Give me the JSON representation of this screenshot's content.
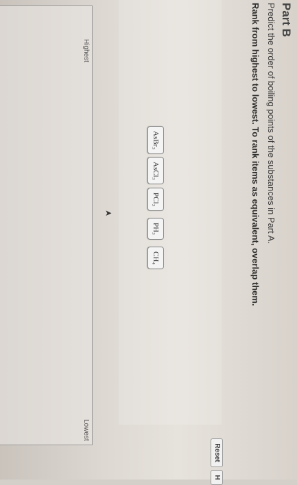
{
  "part": {
    "title": "Part B"
  },
  "question": {
    "instruction": "Predict the order of boiling points of the substances in Part A.",
    "rank_main": "Rank from highest to lowest. To rank items as equivalent, overlap them."
  },
  "toolbar": {
    "reset_label": "Reset",
    "help_label": "H"
  },
  "items": [
    {
      "formula": "AsBr₃"
    },
    {
      "formula": "AsCl₃"
    },
    {
      "formula": "PCl₃"
    },
    {
      "formula": "PH₃"
    },
    {
      "formula": "CH₄"
    }
  ],
  "ranking": {
    "highest_label": "Highest",
    "lowest_label": "Lowest"
  }
}
